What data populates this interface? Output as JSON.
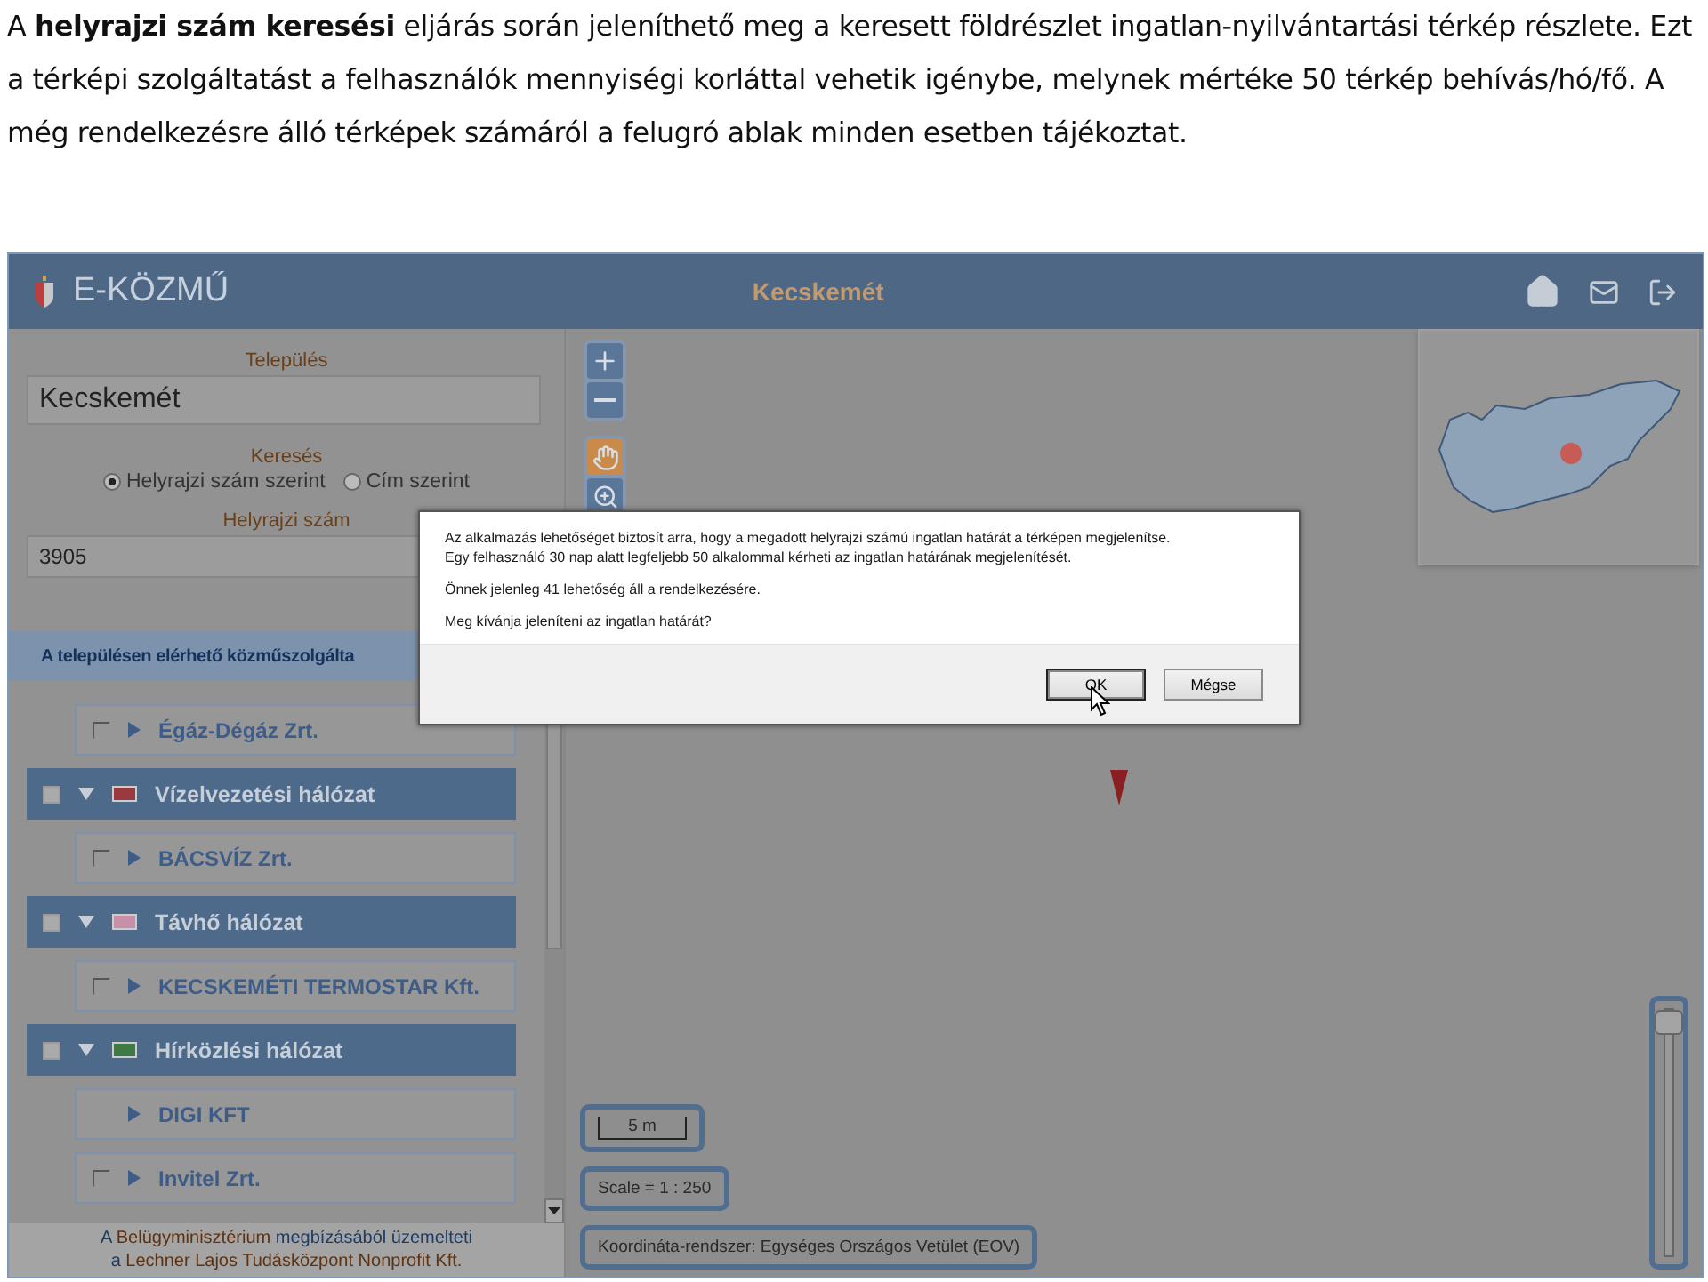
{
  "intro": "A **helyrajzi szám keresési** eljárás során jeleníthető meg a keresett földrészlet ingatlan-nyilvántartási térkép részlete. Ezt a térképi szolgáltatást a felhasználók mennyiségi korláttal vehetik igénybe, melynek mértéke 50 térkép behívás/hó/fő. A még rendelkezésre álló térképek számáról a felugró ablak minden esetben tájékoztat.",
  "app": {
    "logo": "E-KÖZMŰ",
    "title": "Kecskemét"
  },
  "search": {
    "settlement_label": "Település",
    "settlement_value": "Kecskemét",
    "search_label": "Keresés",
    "modes": [
      {
        "label": "Helyrajzi szám szerint",
        "selected": true
      },
      {
        "label": "Cím szerint",
        "selected": false
      }
    ],
    "parcel_label": "Helyrajzi szám",
    "parcel_value": "3905"
  },
  "services_bar": "A településen elérhető közműszolgálta",
  "layers": [
    {
      "kind": "provider",
      "name": "Égáz-Dégáz Zrt.",
      "has_checkbox": true,
      "checked": false
    },
    {
      "kind": "network",
      "name": "Vízelvezetési hálózat",
      "color": "#9a3a3e",
      "checked": false,
      "children": [
        {
          "name": "BÁCSVÍZ Zrt.",
          "has_checkbox": true,
          "checked": false
        }
      ]
    },
    {
      "kind": "network",
      "name": "Távhő hálózat",
      "color": "#c98fa8",
      "checked": false,
      "children": [
        {
          "name": "KECSKEMÉTI TERMOSTAR Kft.",
          "has_checkbox": true,
          "checked": false
        }
      ]
    },
    {
      "kind": "network",
      "name": "Hírközlési hálózat",
      "color": "#3f7a45",
      "checked": false,
      "children": [
        {
          "name": "DIGI KFT",
          "has_checkbox": false
        },
        {
          "name": "Invitel Zrt.",
          "has_checkbox": true,
          "checked": false
        }
      ]
    }
  ],
  "footer": [
    {
      "before": "A ",
      "link": "Belügyminisztérium",
      "after": " megbízásából üzemelteti"
    },
    {
      "before": "a ",
      "link": "Lechner Lajos Tudásközpont Nonprofit Kft."
    }
  ],
  "map": {
    "scale_bar": "5 m",
    "scale": "Scale = 1 : 250",
    "crs": "Koordináta-rendszer: Egységes Országos Vetület (EOV)",
    "zoom": {
      "level": 1
    }
  },
  "dialog": {
    "paragraphs": [
      [
        "Az alkalmazás lehetőséget biztosít arra, hogy a megadott helyrajzi számú ingatlan határát a térképen megjelenítse.",
        "Egy felhasználó 30 nap alatt legfeljebb 50 alkalommal kérheti az ingatlan határának megjelenítését."
      ],
      [
        "Önnek jelenleg 41 lehetőség áll a rendelkezésére."
      ],
      [
        "Meg kívánja jeleníteni az ingatlan határát?"
      ]
    ],
    "buttons": [
      {
        "label": "OK",
        "default": true
      },
      {
        "label": "Mégse",
        "default": false
      }
    ]
  }
}
